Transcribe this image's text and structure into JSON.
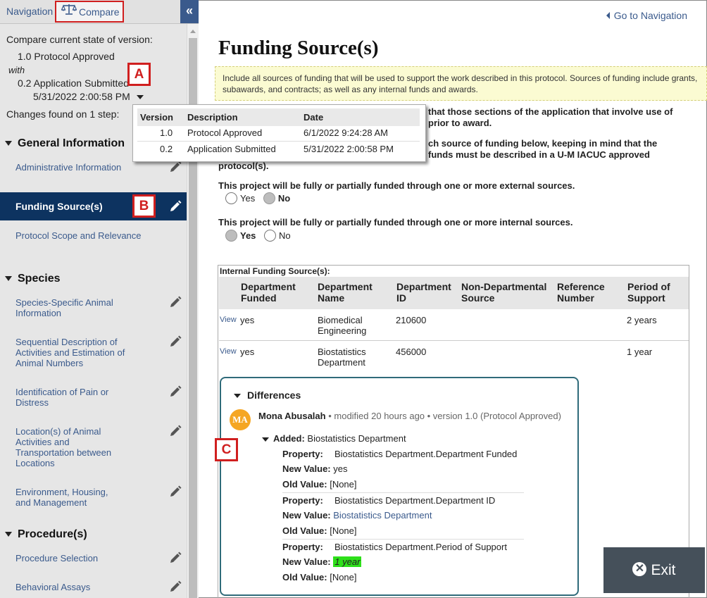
{
  "tabs": {
    "navigation": "Navigation",
    "compare": "Compare"
  },
  "compare_panel": {
    "heading": "Compare current state of version:",
    "version_a": "1.0 Protocol Approved",
    "with_label": "with",
    "version_b": "0.2 Application Submitted",
    "version_b_date": "5/31/2022 2:00:58 PM",
    "changes_found": "Changes found on 1 step:"
  },
  "callouts": {
    "a": "A",
    "b": "B",
    "c": "C"
  },
  "version_popup": {
    "headers": [
      "Version",
      "Description",
      "Date"
    ],
    "rows": [
      {
        "version": "1.0",
        "description": "Protocol Approved",
        "date": "6/1/2022 9:24:28 AM"
      },
      {
        "version": "0.2",
        "description": "Application Submitted",
        "date": "5/31/2022 2:00:58 PM"
      }
    ]
  },
  "sidebar": {
    "sections": [
      {
        "title": "General Information",
        "items": [
          "Administrative Information",
          "Funding Source(s)",
          "Protocol Scope and Relevance"
        ]
      },
      {
        "title": "Species",
        "items": [
          "Species-Specific Animal Information",
          "Sequential Description of Activities and Estimation of Animal Numbers",
          "Identification of Pain or Distress",
          "Location(s) of Animal Activities and Transportation between Locations",
          "Environment, Housing, and Management"
        ]
      },
      {
        "title": "Procedure(s)",
        "items": [
          "Procedure Selection",
          "Behavioral Assays"
        ]
      }
    ]
  },
  "main": {
    "goto_nav": "Go to Navigation",
    "title": "Funding Source(s)",
    "info": "Include all sources of funding that will be used to support the work described in this protocol. Sources of funding include grants, subawards, and contracts; as well as any internal funds and awards.",
    "partial_lines": [
      "that those sections of the application that involve use of",
      "prior to award.",
      "ch source of funding below, keeping in mind that the",
      "funds must be described in a U-M IACUC approved",
      "protocol(s)."
    ],
    "q_external": "This project will be fully or partially funded through one or more external sources.",
    "q_internal": "This project will be fully or partially funded through one or more internal sources.",
    "yes": "Yes",
    "no": "No",
    "external_answer": "No",
    "internal_answer": "Yes"
  },
  "internal_funding": {
    "caption": "Internal Funding Source(s):",
    "columns": [
      "Department Funded",
      "Department Name",
      "Department ID",
      "Non-Departmental Source",
      "Reference Number",
      "Period of Support"
    ],
    "view_label": "View",
    "rows": [
      {
        "funded": "yes",
        "name": "Biomedical Engineering",
        "id": "210600",
        "non_dept": "",
        "ref": "",
        "period": "2 years"
      },
      {
        "funded": "yes",
        "name": "Biostatistics Department",
        "id": "456000",
        "non_dept": "",
        "ref": "",
        "period": "1 year"
      }
    ]
  },
  "differences": {
    "heading": "Differences",
    "avatar_initials": "MA",
    "author": "Mona Abusalah",
    "meta": "• modified 20 hours ago • version 1.0 (Protocol Approved)",
    "added_label": "Added:",
    "added_value": "Biostatistics Department",
    "property_label": "Property:",
    "new_value_label": "New Value:",
    "old_value_label": "Old Value:",
    "changes": [
      {
        "property": "Biostatistics Department.Department Funded",
        "new_value": "yes",
        "old_value": "[None]"
      },
      {
        "property": "Biostatistics Department.Department ID",
        "new_value": "Biostatistics Department",
        "old_value": "[None]"
      },
      {
        "property": "Biostatistics Department.Period of Support",
        "new_value": "1 year",
        "old_value": "[None]"
      }
    ]
  },
  "exit_label": "Exit"
}
